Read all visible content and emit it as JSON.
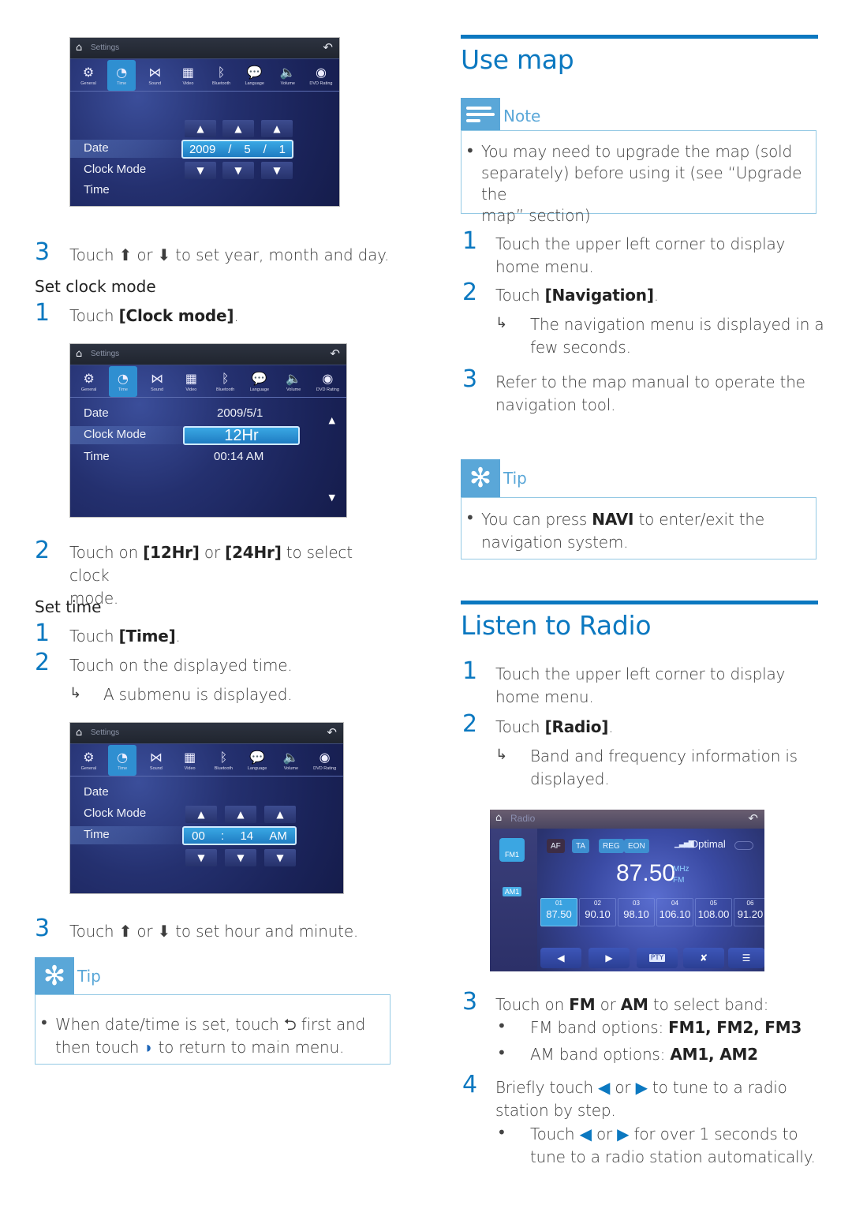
{
  "left": {
    "screen1": {
      "title": "Settings",
      "tabs": [
        "General",
        "Time",
        "Sound",
        "Video",
        "Bluetooth",
        "Language",
        "Volume",
        "DVD Rating"
      ],
      "active_tab": "Time",
      "rows": [
        "Date",
        "Clock Mode",
        "Time"
      ],
      "date_fields": [
        "2009",
        "/",
        "5",
        "/",
        "1"
      ]
    },
    "step3": {
      "num": "3",
      "pre": "Touch",
      "mid": "or",
      "post": "to set year, month and day."
    },
    "set_clock_mode": "Set clock mode",
    "cm_step1": {
      "num": "1",
      "pre": "Touch ",
      "bold": "[Clock mode]",
      "post": "."
    },
    "screen2": {
      "title": "Settings",
      "tabs": [
        "General",
        "Time",
        "Sound",
        "Video",
        "Bluetooth",
        "Language",
        "Volume",
        "DVD Rating"
      ],
      "rows": [
        "Date",
        "Clock Mode",
        "Time"
      ],
      "date_value": "2009/5/1",
      "clock_mode_value": "12Hr",
      "time_value": "00:14  AM"
    },
    "cm_step2": {
      "num": "2",
      "pre": "Touch on ",
      "bold1": "[12Hr]",
      "mid": " or ",
      "bold2": "[24Hr]",
      "post": " to select clock",
      "line2": "mode."
    },
    "set_time": "Set time",
    "t_step1": {
      "num": "1",
      "pre": "Touch ",
      "bold": "[Time]",
      "post": "."
    },
    "t_step2": {
      "num": "2",
      "text": "Touch on the displayed time."
    },
    "t_result": {
      "arrow": "↳",
      "text": "A submenu is displayed."
    },
    "screen3": {
      "title": "Settings",
      "tabs": [
        "General",
        "Time",
        "Sound",
        "Video",
        "Bluetooth",
        "Language",
        "Volume",
        "DVD Rating"
      ],
      "rows": [
        "Date",
        "Clock Mode",
        "Time"
      ],
      "time_fields": [
        "00",
        ":",
        "14",
        "AM"
      ]
    },
    "t_step3": {
      "num": "3",
      "pre": "Touch",
      "mid": "or",
      "post": "to set hour and minute."
    },
    "tip": {
      "label": "Tip",
      "line1_pre": "When date/time is set, touch",
      "line1_post": "first and",
      "line2_pre": "then touch",
      "line2_post": "to return to main menu."
    }
  },
  "right": {
    "use_map": {
      "title": "Use map",
      "note_label": "Note",
      "note_lines": [
        "You may need to upgrade the map (sold",
        "separately) before using it (see “Upgrade the",
        "map” section)"
      ],
      "step1": {
        "num": "1",
        "line1": "Touch the upper left corner to display",
        "line2": "home menu."
      },
      "step2": {
        "num": "2",
        "pre": "Touch ",
        "bold": "[Navigation]",
        "post": "."
      },
      "result": {
        "arrow": "↳",
        "line1": "The navigation menu is displayed in a",
        "line2": "few seconds."
      },
      "step3": {
        "num": "3",
        "line1": "Refer to the map manual to operate the",
        "line2": "navigation tool."
      },
      "tip_label": "Tip",
      "tip_pre": "You can press ",
      "tip_bold": "NAVI",
      "tip_post": " to enter/exit the",
      "tip_line2": "navigation system."
    },
    "radio_section": {
      "title": "Listen to Radio",
      "step1": {
        "num": "1",
        "line1": "Touch the upper left corner to display",
        "line2": "home menu."
      },
      "step2": {
        "num": "2",
        "pre": "Touch ",
        "bold": "[Radio]",
        "post": "."
      },
      "result": {
        "arrow": "↳",
        "line1": "Band and frequency information is",
        "line2": "displayed."
      },
      "step3": {
        "num": "3",
        "pre": "Touch on ",
        "bold1": "FM",
        "mid": " or ",
        "bold2": "AM",
        "post": " to select band:"
      },
      "fm_opts": {
        "pre": "FM band options: ",
        "bold": "FM1, FM2, FM3"
      },
      "am_opts": {
        "pre": "AM band options: ",
        "bold": "AM1, AM2"
      },
      "step4": {
        "num": "4",
        "pre": "Briefly touch",
        "mid": "or",
        "post": "to tune to a radio",
        "line2": "station by step."
      },
      "sub": {
        "pre": "Touch",
        "mid": "or",
        "post": "for over 1 seconds to",
        "line2": "tune to a radio station automatically."
      }
    },
    "radio_screen": {
      "title": "Radio",
      "bands": [
        "FM1",
        "AM1"
      ],
      "flags": [
        "AF",
        "TA",
        "REG",
        "EON"
      ],
      "signal": "Optimal",
      "frequency": "87.50",
      "unit_top": "MHz",
      "unit_bottom": "FM",
      "presets": [
        {
          "num": "01",
          "freq": "87.50"
        },
        {
          "num": "02",
          "freq": "90.10"
        },
        {
          "num": "03",
          "freq": "98.10"
        },
        {
          "num": "04",
          "freq": "106.10"
        },
        {
          "num": "05",
          "freq": "108.00"
        },
        {
          "num": "06",
          "freq": "91.20"
        }
      ],
      "pty_label": "PTY"
    }
  }
}
